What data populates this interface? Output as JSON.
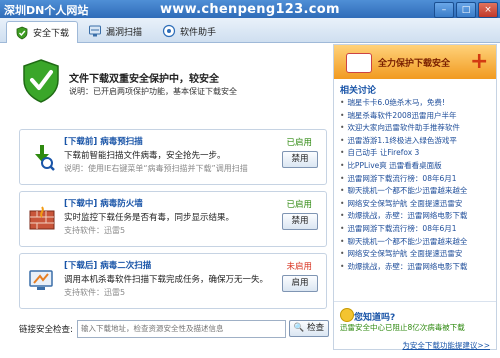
{
  "window": {
    "title": "深圳DN个人网站",
    "url": "www.chenpeng123.com",
    "buttons": [
      "–",
      "□",
      "×"
    ]
  },
  "tabs": [
    {
      "label": "安全下载",
      "icon": "download-shield-icon",
      "active": true
    },
    {
      "label": "漏洞扫描",
      "icon": "scan-icon",
      "active": false
    },
    {
      "label": "软件助手",
      "icon": "software-assistant-icon",
      "active": false
    }
  ],
  "status": {
    "headline": "文件下载双重安全保护中，较安全",
    "description": "说明：已开启两项保护功能，基本保证下载安全"
  },
  "cards": [
    {
      "title": "[下载前] 病毒预扫描",
      "line1": "下载前智能扫描文件病毒，安全抢先一步。",
      "line2": "说明：使用IE右键菜单“病毒预扫描并下载”调用扫描",
      "status": "已启用",
      "status_type": "on",
      "button": "禁用"
    },
    {
      "title": "[下载中] 病毒防火墙",
      "line1": "实时监控下载任务是否有毒，同步显示结果。",
      "line2": "支持软件：迅雷5",
      "status": "已启用",
      "status_type": "on",
      "button": "禁用"
    },
    {
      "title": "[下载后] 病毒二次扫描",
      "line1": "调用本机杀毒软件扫描下载完成任务，确保万无一失。",
      "line2": "支持软件：迅雷5",
      "status": "未启用",
      "status_type": "off",
      "button": "启用"
    }
  ],
  "link_check": {
    "label": "链接安全检查:",
    "placeholder": "输入下载地址，检查资源安全性及描述信息",
    "button": "检查"
  },
  "side": {
    "promo": "全力保护下载安全",
    "heading": "相关讨论",
    "news": [
      "瑞星卡卡6.0绝杀木马，免费!",
      "瑞星杀毒软件2008迅雷用户半年",
      "欢迎大家向迅雷软件助手推荐软件",
      "迅雷游游1.1终极进入绿色游戏平",
      "自己动手 让Firefox 3",
      "比PPLive爽 迅雷看看桌面版",
      "迅雷网游下载流行榜：08年6月1",
      "聊天挑机一个都不能少迅雷越来越全",
      "网络安全保驾护航 全面提速迅雷安",
      "劲爆挑战，赤壁：迅雷网络电影下载",
      "迅雷网游下载流行榜：08年6月1",
      "聊天挑机一个都不能少迅雷越来越全",
      "网络安全保驾护航 全面提速迅雷安",
      "劲爆挑战，赤壁：迅雷网络电影下载"
    ],
    "know_heading": "您知道吗?",
    "know_text": "迅雷安全中心已阻止8亿次病毒被下载",
    "suggest": "为安全下载功能提建议>>"
  }
}
